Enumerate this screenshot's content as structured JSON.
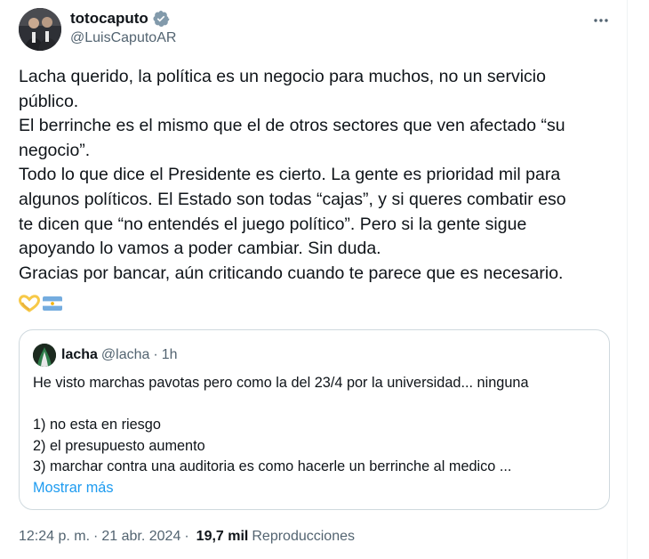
{
  "author": {
    "name": "totocaputo",
    "handle": "@LuisCaputoAR",
    "verified": true
  },
  "tweet": {
    "lines": [
      "Lacha querido, la política es un negocio para muchos, no un servicio",
      "público.",
      "El berrinche es el mismo que el de otros sectores que ven afectado “su",
      "negocio”.",
      "Todo lo que dice el Presidente es cierto. La gente es prioridad mil para",
      "algunos políticos. El Estado son todas “cajas”, y si queres combatir eso",
      "te dicen que “no entendés el juego político”. Pero si la gente sigue",
      "apoyando lo vamos a poder cambiar. Sin duda.",
      "Gracias por bancar, aún criticando cuando te parece que es necesario."
    ],
    "emojis": [
      "heart-hands-emoji",
      "argentina-flag-emoji"
    ]
  },
  "quote": {
    "name": "lacha",
    "handle": "@lacha",
    "dot": "·",
    "time": "1h",
    "lines": [
      "He visto marchas pavotas pero como la del 23/4 por la universidad... ninguna",
      "",
      "1) no esta en riesgo",
      "2) el presupuesto aumento",
      "3) marchar contra una auditoria es como hacerle un berrinche al medico ..."
    ],
    "show_more": "Mostrar más"
  },
  "meta": {
    "time": "12:24 p. m.",
    "separator": "·",
    "date": "21 abr. 2024",
    "views_count": "19,7 mil",
    "views_label": "Reproducciones"
  },
  "colors": {
    "accent": "#1d9bf0",
    "text": "#0f1419",
    "secondary": "#536471",
    "border": "#cfd9de"
  }
}
